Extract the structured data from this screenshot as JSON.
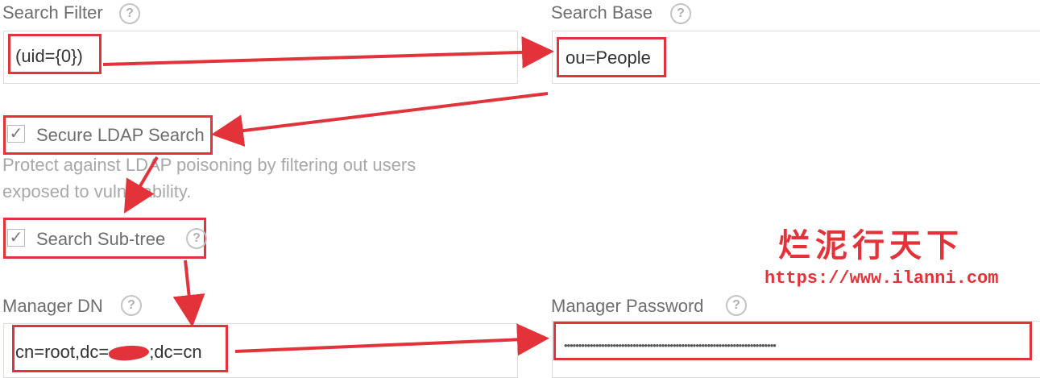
{
  "search_filter": {
    "label": "Search Filter",
    "value": "(uid={0})"
  },
  "search_base": {
    "label": "Search Base",
    "value": "ou=People"
  },
  "secure_ldap": {
    "label": "Secure LDAP Search",
    "checked": true,
    "check_glyph": "✓",
    "description_line1": "Protect against LDAP poisoning by filtering out users",
    "description_line2": "exposed to vulnerability."
  },
  "search_subtree": {
    "label": "Search Sub-tree",
    "checked": true,
    "check_glyph": "✓"
  },
  "manager_dn": {
    "label": "Manager DN",
    "value_prefix": "cn=root,dc=",
    "value_suffix": ";dc=cn"
  },
  "manager_password": {
    "label": "Manager Password",
    "value": "••••••••••••••••••••••••••••••••••••••••••••••••••••••••••••••••••••••••••"
  },
  "help_glyph": "?",
  "watermark": {
    "text_cn": "烂泥行天下",
    "url": "https://www.ilanni.com"
  },
  "colors": {
    "annotation_red": "#e2333b",
    "label_gray": "#6e6e6e",
    "field_border": "#dcdcdc"
  },
  "icons": {
    "help": "question-circle-icon",
    "checkbox": "checkmark-icon",
    "arrow": "red-arrow"
  }
}
